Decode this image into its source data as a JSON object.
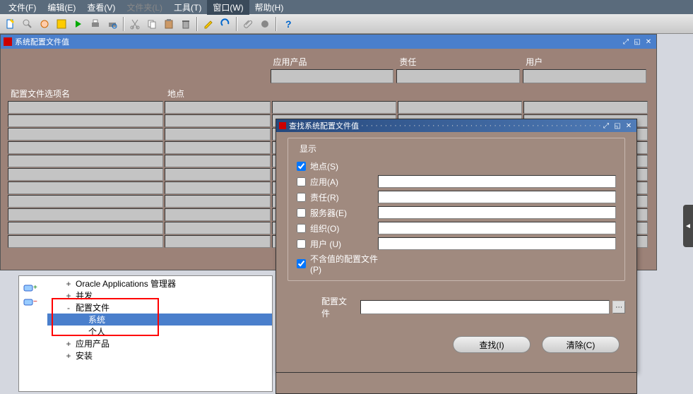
{
  "menubar": {
    "items": [
      {
        "label": "文件(F)"
      },
      {
        "label": "编辑(E)"
      },
      {
        "label": "查看(V)"
      },
      {
        "label": "文件夹(L)",
        "disabled": true
      },
      {
        "label": "工具(T)"
      },
      {
        "label": "窗口(W)",
        "active": true
      },
      {
        "label": "帮助(H)"
      }
    ]
  },
  "toolbar": {
    "icons": [
      "new-doc",
      "find",
      "flashlight",
      "save",
      "next",
      "print",
      "print-preview",
      "|",
      "cut",
      "copy",
      "paste",
      "delete",
      "|",
      "edit",
      "undo",
      "|",
      "attach",
      "tools",
      "|",
      "help"
    ]
  },
  "window1": {
    "title": "系统配置文件值",
    "top_labels": {
      "app": "应用产品",
      "resp": "责任",
      "user": "用户"
    },
    "col_labels": {
      "profile": "配置文件选项名",
      "site": "地点"
    },
    "grid_rows": 11
  },
  "tree": {
    "items": [
      {
        "level": 1,
        "expand": "+",
        "label": "Oracle Applications 管理器"
      },
      {
        "level": 1,
        "expand": "+",
        "label": "并发"
      },
      {
        "level": 1,
        "expand": "-",
        "label": "配置文件"
      },
      {
        "level": 2,
        "expand": "",
        "label": "系统",
        "selected": true
      },
      {
        "level": 2,
        "expand": "",
        "label": "个人"
      },
      {
        "level": 1,
        "expand": "+",
        "label": "应用产品"
      },
      {
        "level": 1,
        "expand": "+",
        "label": "安装"
      }
    ]
  },
  "dialog": {
    "title": "查找系统配置文件值",
    "fieldset_legend": "显示",
    "rows": [
      {
        "key": "site",
        "label": "地点(S)",
        "checked": true,
        "has_input": false
      },
      {
        "key": "app",
        "label": "应用(A)",
        "checked": false,
        "has_input": true
      },
      {
        "key": "resp",
        "label": "责任(R)",
        "checked": false,
        "has_input": true
      },
      {
        "key": "server",
        "label": "服务器(E)",
        "checked": false,
        "has_input": true
      },
      {
        "key": "org",
        "label": "组织(O)",
        "checked": false,
        "has_input": true
      },
      {
        "key": "user",
        "label": "用户 (U)",
        "checked": false,
        "has_input": true
      }
    ],
    "novalue_label": "不含值的配置文件(P)",
    "novalue_checked": true,
    "profile_label": "配置文件",
    "find_button": "查找(I)",
    "clear_button": "清除(C)"
  },
  "side_handle": "◄"
}
